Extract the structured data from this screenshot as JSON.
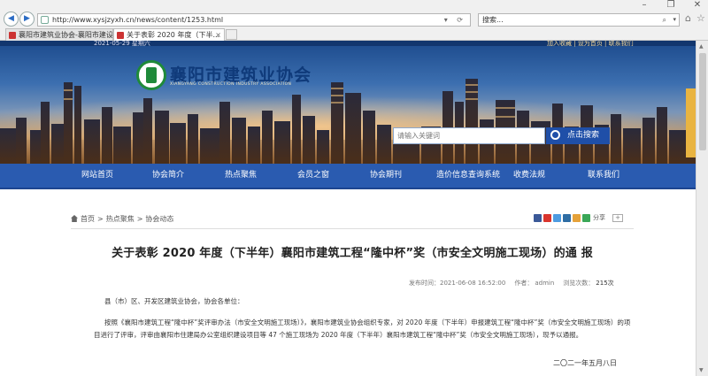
{
  "browser": {
    "url": "http://www.xysjzyxh.cn/news/content/1253.html",
    "search_value": "搜索...",
    "tabs": [
      {
        "label": "襄阳市建筑业协会-襄阳市建设..."
      },
      {
        "label": "关于表彰 2020 年度（下半..."
      }
    ]
  },
  "header": {
    "date": "2021-05-29 星期六",
    "top_links": "加入收藏 | 设为首页 | 联系我们",
    "site_name": "襄阳市建筑业协会",
    "site_subtitle": "XIANGYANG CONSTRUCTION INDUSTRY ASSOCIATION",
    "search_placeholder": "请输入关键词",
    "search_button": "点击搜索"
  },
  "nav": {
    "items": [
      "网站首页",
      "协会简介",
      "热点聚焦",
      "会员之窗",
      "协会期刊",
      "造价信息查询系统",
      "收费法规",
      "联系我们"
    ]
  },
  "breadcrumb": [
    "首页",
    "热点聚焦",
    "协会动态"
  ],
  "share": {
    "label": "分享",
    "plus": "+"
  },
  "article": {
    "title": "关于表彰 2020 年度（下半年）襄阳市建筑工程“隆中杯”奖（市安全文明施工现场）的通 报",
    "publish_label": "发布时间：2021-06-08 16:52:00",
    "author_label": "作者：",
    "author": "admin",
    "views_label": "浏览次数：",
    "views": "215次",
    "salutation": "县（市）区、开发区建筑业协会，协会各单位：",
    "body": "按照《襄阳市建筑工程“隆中杯”奖评审办法（市安全文明施工现场）》，襄阳市建筑业协会组织专家，对 2020 年度（下半年）申报建筑工程“隆中杯”奖（市安全文明施工现场）的项目进行了评审，评审由襄阳市住建局办公室组织建设项目等 47 个施工现场为 2020 年度（下半年）襄阳市建筑工程“隆中杯”奖（市安全文明施工现场），现予以通报。",
    "date": "二〇二一年五月八日"
  },
  "colors": {
    "nav": "#2a5bb0",
    "brand": "#0f3a7a",
    "accent": "#e9b441"
  }
}
